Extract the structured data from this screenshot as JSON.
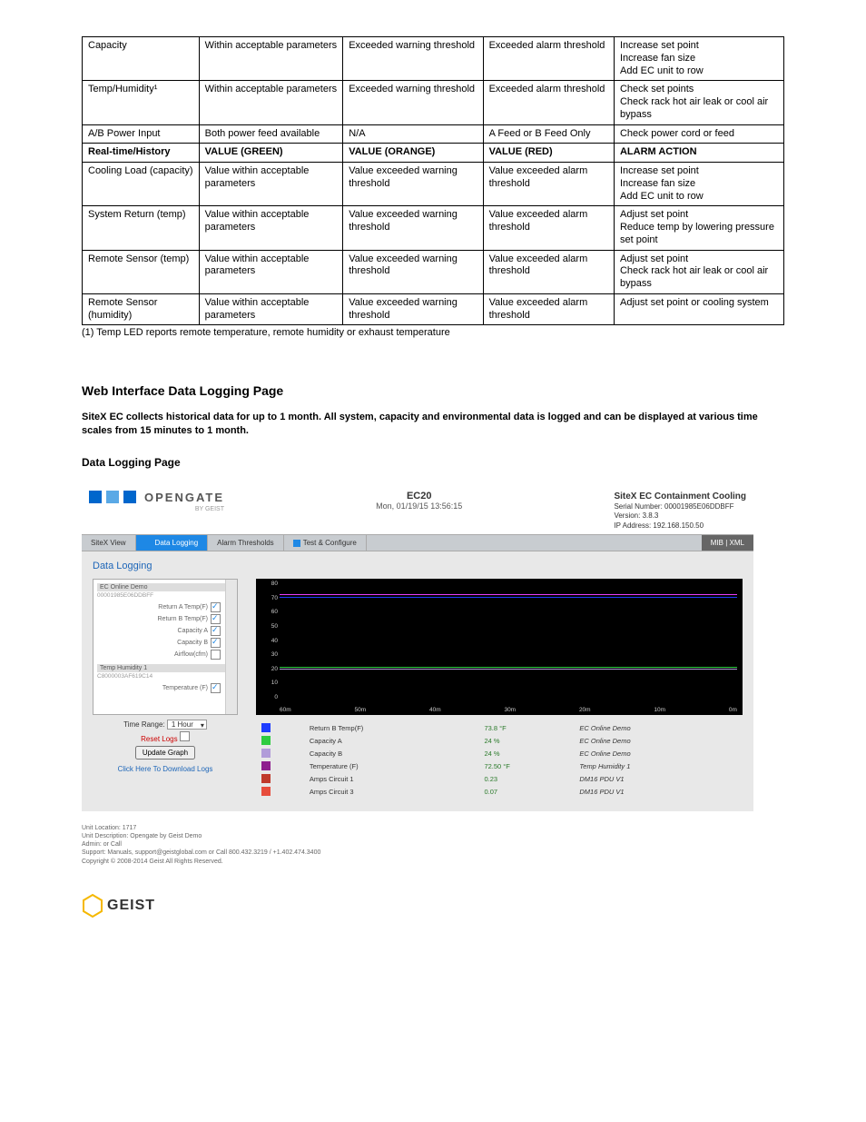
{
  "table": {
    "rows": [
      {
        "c0": "Capacity",
        "c1": "Within acceptable parameters",
        "c2": "Exceeded warning threshold",
        "c3": "Exceeded alarm threshold",
        "c4": "Increase set point\nIncrease fan size\nAdd EC unit to row"
      },
      {
        "c0": "Temp/Humidity¹",
        "c1": "Within acceptable parameters",
        "c2": "Exceeded warning threshold",
        "c3": "Exceeded alarm threshold",
        "c4": "Check set points\nCheck rack hot air leak or cool air bypass"
      },
      {
        "c0": "A/B Power Input",
        "c1": "Both power feed available",
        "c2": "N/A",
        "c3": "A Feed or B Feed Only",
        "c4": "Check power cord or feed"
      }
    ],
    "hdr": {
      "c0": "Real-time/History",
      "c1": "VALUE (GREEN)",
      "c2": "VALUE (ORANGE)",
      "c3": "VALUE (RED)",
      "c4": "ALARM ACTION"
    },
    "rows2": [
      {
        "c0": "Cooling Load (capacity)",
        "c1": "Value within acceptable parameters",
        "c2": "Value exceeded warning threshold",
        "c3": "Value exceeded alarm threshold",
        "c4": "Increase set point\nIncrease fan size\nAdd EC unit to row"
      },
      {
        "c0": "System Return (temp)",
        "c1": "Value within acceptable parameters",
        "c2": "Value exceeded warning threshold",
        "c3": "Value exceeded alarm threshold",
        "c4": "Adjust set point\nReduce temp by lowering pressure set point"
      },
      {
        "c0": "Remote Sensor (temp)",
        "c1": "Value within acceptable parameters",
        "c2": "Value exceeded warning threshold",
        "c3": "Value exceeded alarm threshold",
        "c4": "Adjust set point\nCheck rack hot air leak or cool air bypass"
      },
      {
        "c0": "Remote Sensor (humidity)",
        "c1": "Value within acceptable parameters",
        "c2": "Value exceeded warning threshold",
        "c3": "Value exceeded alarm threshold",
        "c4": "Adjust set point or cooling system"
      }
    ]
  },
  "footnote": "(1) Temp LED reports remote temperature, remote humidity or exhaust temperature",
  "section_title": "Web Interface Data Logging Page",
  "intro": "SiteX EC collects historical data for up to 1 month.  All system, capacity and environmental data is logged and can be displayed at various time scales from 15 minutes to 1 month.",
  "sub_title": "Data Logging Page",
  "webui": {
    "logo_text": "OPENGATE",
    "by": "BY GEIST",
    "center_title": "EC20",
    "center_time": "Mon, 01/19/15 13:56:15",
    "right_title": "SiteX EC Containment Cooling",
    "right_serial": "Serial Number: 00001985E06DDBFF",
    "right_version": "Version: 3.8.3",
    "right_ip": "IP Address: 192.168.150.50",
    "tabs": {
      "t0": "SiteX View",
      "t1": "Data Logging",
      "t2": "Alarm Thresholds",
      "t3": "Test & Configure"
    },
    "right_links": "MIB  |  XML",
    "page_title": "Data Logging",
    "listbox": {
      "g1_title": "EC Online Demo",
      "g1_sub": "00001985E06DDBFF",
      "opts": [
        {
          "label": "Return A Temp(F)",
          "on": true
        },
        {
          "label": "Return B Temp(F)",
          "on": true
        },
        {
          "label": "Capacity A",
          "on": true
        },
        {
          "label": "Capacity B",
          "on": true
        },
        {
          "label": "Airflow(cfm)",
          "on": false
        }
      ],
      "g2_title": "Temp Humidity 1",
      "g2_sub": "C8000003AF619C14",
      "opts2": [
        {
          "label": "Temperature (F)",
          "on": true
        }
      ]
    },
    "controls": {
      "time_range_label": "Time Range:",
      "time_range_value": "1 Hour",
      "reset": "Reset Logs",
      "update": "Update Graph",
      "download": "Click Here To Download Logs"
    },
    "yaxis": [
      "80",
      "70",
      "60",
      "50",
      "40",
      "30",
      "20",
      "10",
      "0"
    ],
    "xaxis": [
      "60m",
      "50m",
      "40m",
      "30m",
      "20m",
      "10m",
      "0m"
    ],
    "legend": [
      {
        "color": "#1e3cff",
        "name": "Return B Temp(F)",
        "val": "73.8 °F",
        "src": "EC Online Demo"
      },
      {
        "color": "#2ecc40",
        "name": "Capacity A",
        "val": "24 %",
        "src": "EC Online Demo"
      },
      {
        "color": "#b19cd9",
        "name": "Capacity B",
        "val": "24 %",
        "src": "EC Online Demo"
      },
      {
        "color": "#8e1e8e",
        "name": "Temperature (F)",
        "val": "72.50 °F",
        "src": "Temp Humidity 1"
      },
      {
        "color": "#c0392b",
        "name": "Amps Circuit 1",
        "val": "0.23",
        "src": "DM16 PDU V1"
      },
      {
        "color": "#e74c3c",
        "name": "Amps Circuit 3",
        "val": "0.07",
        "src": "DM16 PDU V1"
      }
    ],
    "footer": {
      "loc": "Unit Location: 1717",
      "desc": "Unit Description: Opengate by Geist Demo",
      "admin": "Admin: or Call",
      "support": "Support: Manuals, support@geistglobal.com or Call 800.432.3219 / +1.402.474.3400",
      "copy": "Copyright © 2008-2014 Geist All Rights Reserved."
    }
  },
  "geist_text": "GEIST"
}
